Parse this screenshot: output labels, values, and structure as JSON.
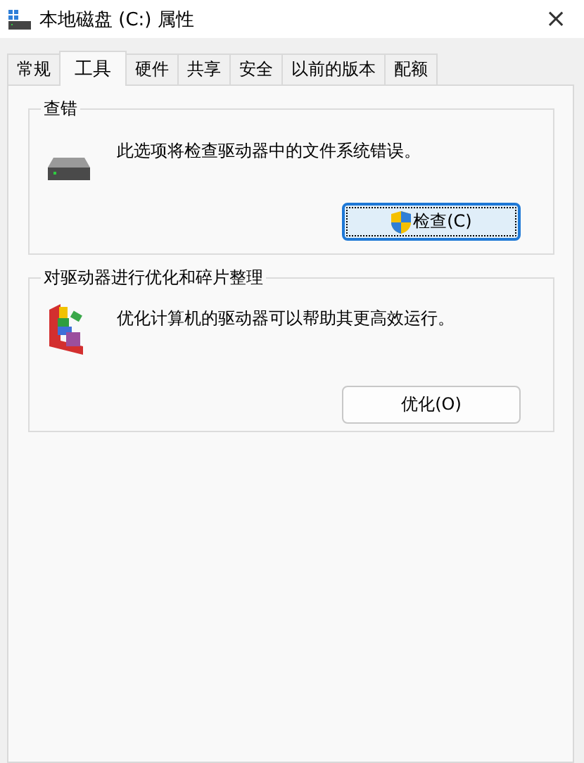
{
  "window": {
    "title": "本地磁盘 (C:) 属性",
    "close": "×"
  },
  "tabs": [
    {
      "label": "常规",
      "selected": false
    },
    {
      "label": "工具",
      "selected": true
    },
    {
      "label": "硬件",
      "selected": false
    },
    {
      "label": "共享",
      "selected": false
    },
    {
      "label": "安全",
      "selected": false
    },
    {
      "label": "以前的版本",
      "selected": false
    },
    {
      "label": "配额",
      "selected": false
    }
  ],
  "groups": [
    {
      "kind": "check",
      "title": "查错",
      "description": "此选项将检查驱动器中的文件系统错误。",
      "button": {
        "label": "检查(C)",
        "focused": true,
        "shield": true
      }
    },
    {
      "kind": "optimize",
      "title": "对驱动器进行优化和碎片整理",
      "description": "优化计算机的驱动器可以帮助其更高效运行。",
      "button": {
        "label": "优化(O)",
        "focused": false,
        "shield": false
      }
    }
  ]
}
